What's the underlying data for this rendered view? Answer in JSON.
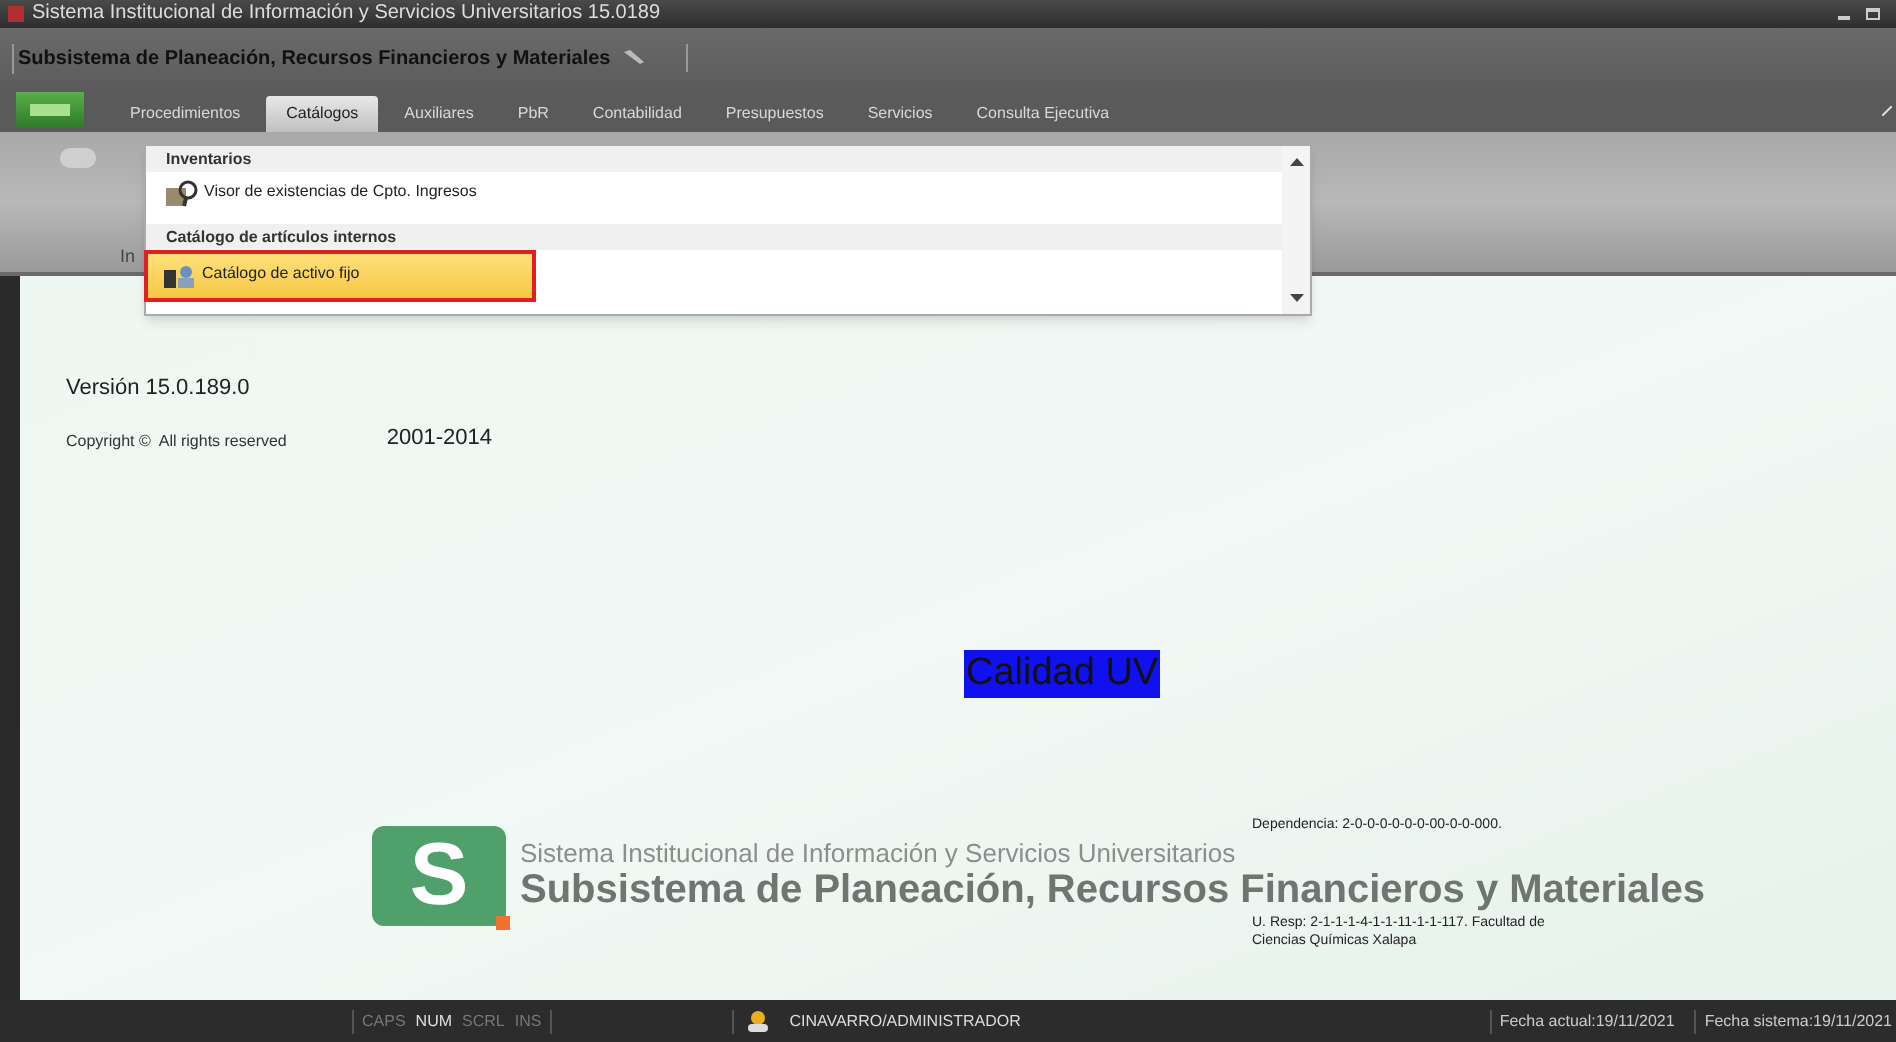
{
  "window": {
    "title": "Sistema Institucional de Información y Servicios Universitarios 15.0189"
  },
  "subsystem": {
    "title": "Subsistema de Planeación, Recursos Financieros y Materiales"
  },
  "tabs": [
    {
      "label": "Procedimientos",
      "selected": false
    },
    {
      "label": "Catálogos",
      "selected": true
    },
    {
      "label": "Auxiliares",
      "selected": false
    },
    {
      "label": "PbR",
      "selected": false
    },
    {
      "label": "Contabilidad",
      "selected": false
    },
    {
      "label": "Presupuestos",
      "selected": false
    },
    {
      "label": "Servicios",
      "selected": false
    },
    {
      "label": "Consulta Ejecutiva",
      "selected": false
    }
  ],
  "ribbon": {
    "label": "In"
  },
  "menu": {
    "groups": [
      {
        "heading": "Inventarios",
        "items": [
          {
            "label": "Visor de existencias de Cpto. Ingresos",
            "selected": false
          }
        ]
      },
      {
        "heading": "Catálogo de artículos internos",
        "items": [
          {
            "label": "Catálogo de activo fijo",
            "selected": true
          }
        ]
      }
    ]
  },
  "about": {
    "version": "Versión 15.0.189.0",
    "copyright": "Copyright ©  All rights reserved",
    "years": "2001-2014"
  },
  "badge": "Calidad UV",
  "branding": {
    "logo_letter": "S",
    "line1": "Sistema Institucional de Información y Servicios Universitarios",
    "line2": "Subsistema de Planeación, Recursos Financieros y Materiales"
  },
  "dependencia": "Dependencia: 2-0-0-0-0-0-0-00-0-0-000.",
  "u_resp": "U. Resp: 2-1-1-1-4-1-1-11-1-1-117. Facultad de Ciencias Químicas Xalapa",
  "status_bar": {
    "keys": [
      {
        "label": "CAPS",
        "on": false
      },
      {
        "label": "NUM",
        "on": true
      },
      {
        "label": "SCRL",
        "on": false
      },
      {
        "label": "INS",
        "on": false
      }
    ],
    "user": "CINAVARRO/ADMINISTRADOR",
    "fecha_actual": "Fecha actual:19/11/2021",
    "fecha_sistema": "Fecha sistema:19/11/2021"
  }
}
